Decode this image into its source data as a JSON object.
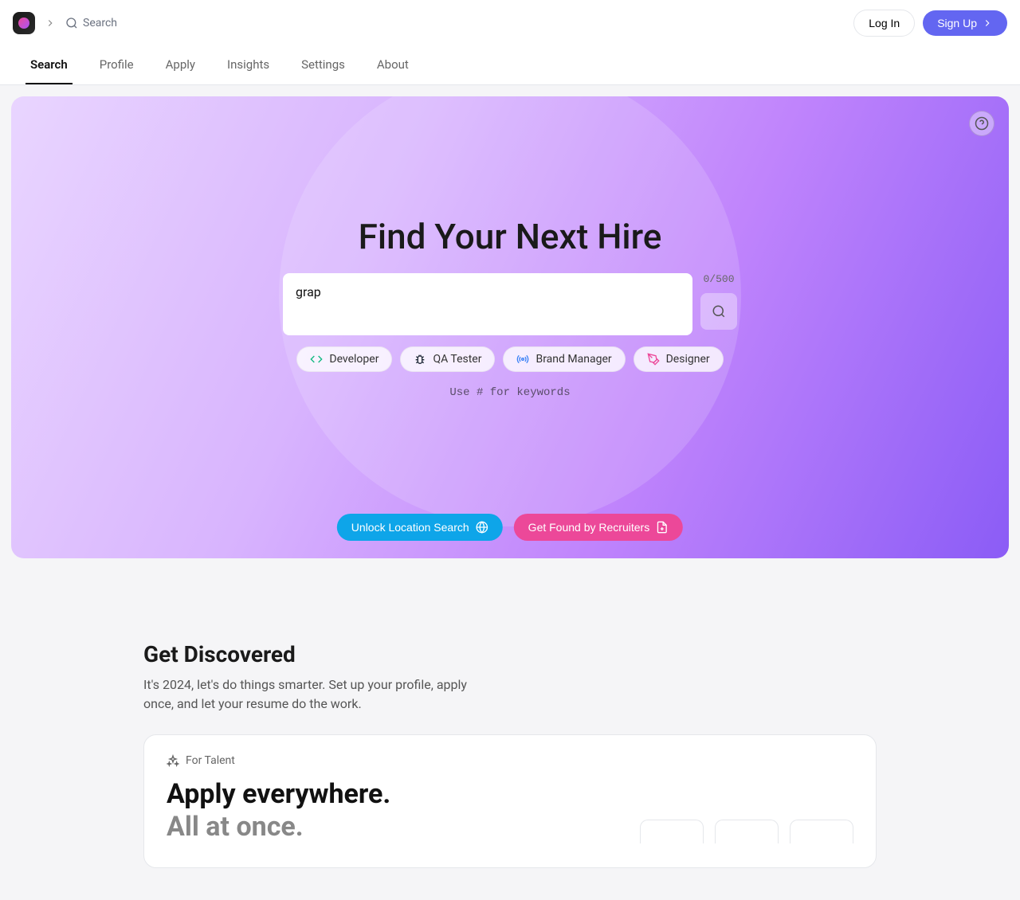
{
  "header": {
    "search_placeholder": "Search",
    "login_label": "Log In",
    "signup_label": "Sign Up"
  },
  "nav": {
    "tabs": [
      "Search",
      "Profile",
      "Apply",
      "Insights",
      "Settings",
      "About"
    ],
    "active_index": 0
  },
  "hero": {
    "title": "Find Your Next Hire",
    "search_value": "grap",
    "char_count": "0/500",
    "chips": [
      "Developer",
      "QA Tester",
      "Brand Manager",
      "Designer"
    ],
    "hint": "Use # for keywords",
    "cta_unlock": "Unlock Location Search",
    "cta_found": "Get Found by Recruiters"
  },
  "discover": {
    "title": "Get Discovered",
    "subtitle": "It's 2024, let's do things smarter. Set up your profile, apply once, and let your resume do the work.",
    "card_tag": "For Talent",
    "card_line1": "Apply everywhere.",
    "card_line2": "All at once."
  }
}
